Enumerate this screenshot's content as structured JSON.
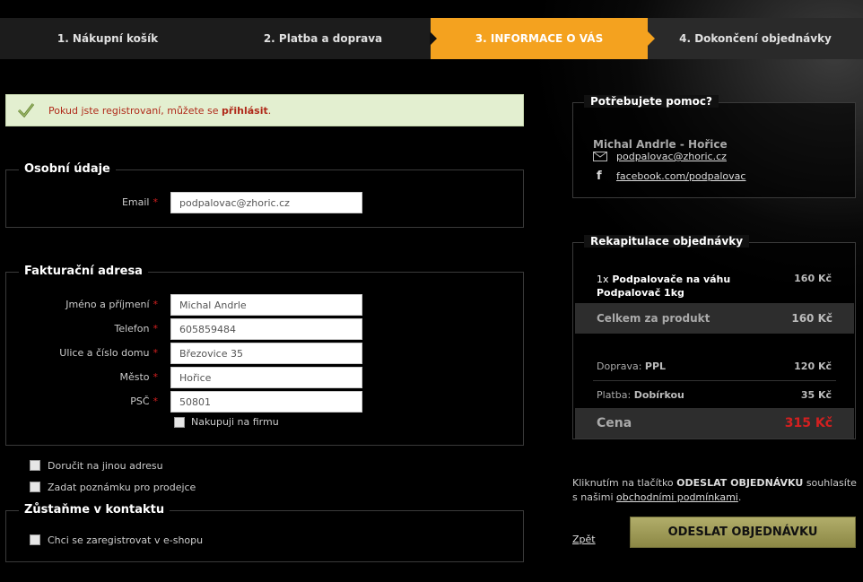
{
  "steps": [
    {
      "label": "1. Nákupní košík"
    },
    {
      "label": "2. Platba a doprava"
    },
    {
      "label": "3. INFORMACE O VÁS"
    },
    {
      "label": "4. Dokončení objednávky"
    }
  ],
  "notice": {
    "text_before": "Pokud jste registrovaní, můžete se ",
    "link": "přihlásit",
    "text_after": "."
  },
  "personal": {
    "legend": "Osobní údaje",
    "email_label": "Email",
    "email_value": "podpalovac@zhoric.cz"
  },
  "billing": {
    "legend": "Fakturační adresa",
    "fields": [
      {
        "label": "Jméno a příjmení",
        "value": "Michal Andrle"
      },
      {
        "label": "Telefon",
        "value": "605859484"
      },
      {
        "label": "Ulice a číslo domu",
        "value": "Březovice 35"
      },
      {
        "label": "Město",
        "value": "Hořice"
      },
      {
        "label": "PSČ",
        "value": "50801"
      }
    ],
    "company_label": "Nakupuji na firmu"
  },
  "options": {
    "other_address": "Doručit na jinou adresu",
    "seller_note": "Zadat poznámku pro prodejce"
  },
  "contact": {
    "legend": "Zůstaňme v kontaktu",
    "register_label": "Chci se zaregistrovat v e-shopu"
  },
  "required_mark": "*",
  "help": {
    "legend": "Potřebujete pomoc?",
    "name": "Michal Andrle - Hořice",
    "email": "podpalovac@zhoric.cz",
    "facebook_glyph": "f",
    "facebook": "facebook.com/podpalovac"
  },
  "summary": {
    "legend": "Rekapitulace objednávky",
    "item_qty": "1x",
    "item_name_line1": "Podpalovače na váhu",
    "item_name_line2": "Podpalovač 1kg",
    "item_price": "160 Kč",
    "product_total_label": "Celkem za produkt",
    "product_total": "160 Kč",
    "shipping_label": "Doprava:",
    "shipping_method": "PPL",
    "shipping_price": "120 Kč",
    "payment_label": "Platba:",
    "payment_method": "Dobírkou",
    "payment_price": "35 Kč",
    "total_label": "Cena",
    "total": "315 Kč"
  },
  "terms": {
    "text_before": "Kliknutím na tlačítko ",
    "button_ref": "ODESLAT OBJEDNÁVKU",
    "text_middle": " souhlasíte s našimi ",
    "link": "obchodními podmínkami",
    "text_after": "."
  },
  "back_label": "Zpět",
  "submit_label": "ODESLAT OBJEDNÁVKU",
  "colors": {
    "active_step": "#f4a21f",
    "total_price": "#d42020",
    "submit_button": "#a8a45f"
  }
}
